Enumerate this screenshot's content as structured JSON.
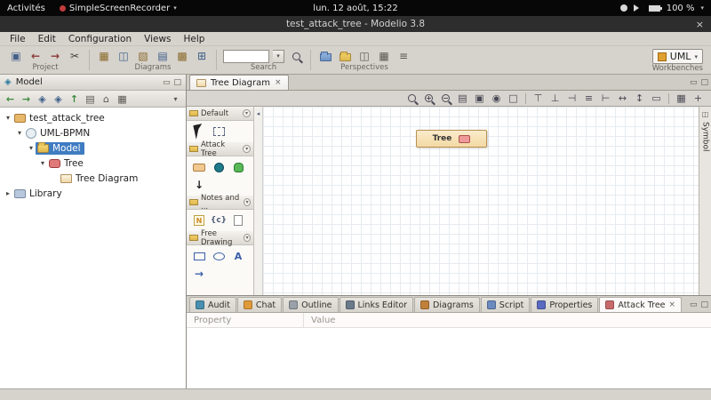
{
  "glyphs": {
    "close": "×",
    "caret": "▾",
    "expander_open": "▾",
    "expander_closed": "▸",
    "collapse_left": "◂",
    "toggle": "▾",
    "back": "←",
    "forward": "→",
    "up": "↑",
    "down": "↓",
    "scissors": "✂",
    "floppy": "▣",
    "print": "▤",
    "camera": "◉",
    "select_box": "□",
    "align_top": "⊤",
    "align_bottom": "⊥",
    "align_left": "⊣",
    "align_right": "⊢",
    "align_center": "≡",
    "dist_h": "↔",
    "dist_v": "↕",
    "same_size": "▭",
    "grid": "▦",
    "snap": "+",
    "diag1": "▦",
    "diag2": "◫",
    "diag3": "▧",
    "diag4": "▤",
    "diag5": "▩",
    "diag6": "⊞",
    "persp3": "◫",
    "persp4": "▦",
    "persp5": "≡",
    "links": "◈",
    "links2": "◈",
    "flat_view": "▤",
    "home": "⌂",
    "tree_options": "▦",
    "win_min": "▭",
    "win_max": "□",
    "model_panel_ico": "◈",
    "symbol_ico": "◫"
  },
  "system_bar": {
    "activities": "Activités",
    "recorder": "SimpleScreenRecorder",
    "clock": "lun. 12 août, 15:22",
    "battery": "100 %"
  },
  "window": {
    "title": "test_attack_tree - Modelio 3.8"
  },
  "menu_bar": {
    "items": [
      "File",
      "Edit",
      "Configuration",
      "Views",
      "Help"
    ]
  },
  "toolbar": {
    "project_label": "Project",
    "diagrams_label": "Diagrams",
    "search_label": "Search",
    "search_value": "",
    "perspectives_label": "Perspectives",
    "workbenches_label": "Workbenches",
    "workbench_value": "UML"
  },
  "model_panel": {
    "title": "Model",
    "tree": [
      {
        "label": "test_attack_tree",
        "level": 0,
        "expander": "▾",
        "selected": false
      },
      {
        "label": "UML-BPMN",
        "level": 1,
        "expander": "▾",
        "selected": false
      },
      {
        "label": "Model",
        "level": 2,
        "expander": "▾",
        "selected": true
      },
      {
        "label": "Tree",
        "level": 3,
        "expander": "▾",
        "selected": false
      },
      {
        "label": "Tree Diagram",
        "level": 4,
        "expander": "",
        "selected": false
      },
      {
        "label": "Library",
        "level": 0,
        "expander": "▸",
        "selected": false
      }
    ]
  },
  "editor": {
    "tab_label": "Tree Diagram",
    "symbol_tab": "Symbol",
    "node_label": "Tree",
    "palette": {
      "groups": [
        {
          "label": "Default"
        },
        {
          "label": "Attack Tree"
        },
        {
          "label": "Notes and ..."
        },
        {
          "label": "Free Drawing"
        }
      ],
      "note": "N",
      "constraint": "{c}",
      "text": "A"
    }
  },
  "bottom_panel": {
    "active_tab": "Attack Tree",
    "tabs": [
      "Audit",
      "Chat",
      "Outline",
      "Links Editor",
      "Diagrams",
      "Script",
      "Properties",
      "Attack Tree"
    ],
    "table": {
      "columns": [
        "Property",
        "Value"
      ]
    }
  }
}
